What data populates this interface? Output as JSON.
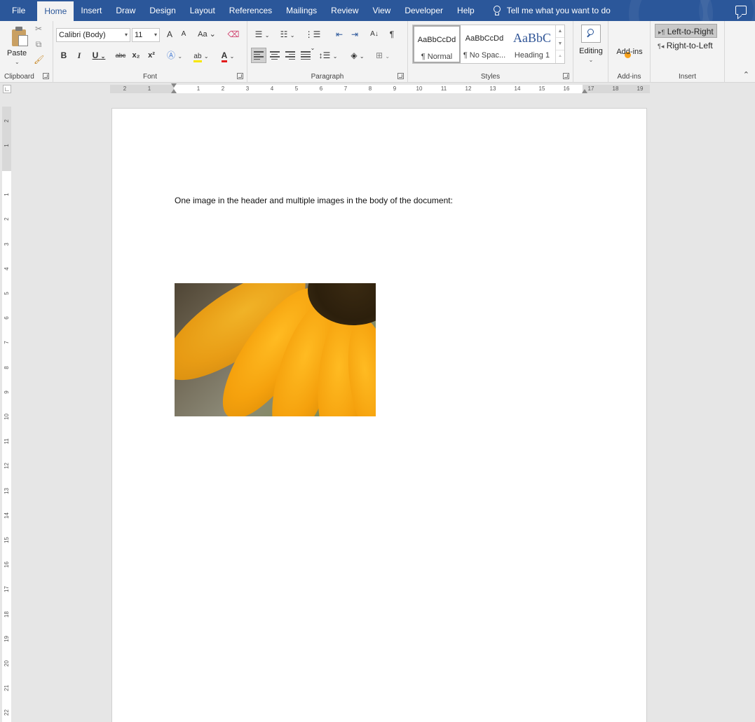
{
  "menu": {
    "tabs": [
      "File",
      "Home",
      "Insert",
      "Draw",
      "Design",
      "Layout",
      "References",
      "Mailings",
      "Review",
      "View",
      "Developer",
      "Help"
    ],
    "active_tab": "Home",
    "tell_me": "Tell me what you want to do"
  },
  "ribbon": {
    "clipboard": {
      "paste_label": "Paste",
      "group_label": "Clipboard"
    },
    "font": {
      "font_name": "Calibri (Body)",
      "font_size": "11",
      "grow": "A",
      "shrink": "A",
      "change_case": "Aa",
      "bold": "B",
      "italic": "I",
      "underline": "U",
      "strikethrough": "abc",
      "subscript": "x₂",
      "superscript": "x²",
      "font_color": "A",
      "group_label": "Font"
    },
    "paragraph": {
      "pilcrow": "¶",
      "group_label": "Paragraph"
    },
    "styles": {
      "items": [
        {
          "sample": "AaBbCcDd",
          "name": "¶ Normal"
        },
        {
          "sample": "AaBbCcDd",
          "name": "¶ No Spac..."
        },
        {
          "sample": "AaBbC",
          "name": "Heading 1"
        }
      ],
      "group_label": "Styles"
    },
    "editing": {
      "label": "Editing"
    },
    "addins": {
      "label": "Add-ins",
      "group_label": "Add-ins"
    },
    "insert": {
      "ltr": "Left-to-Right",
      "rtl": "Right-to-Left",
      "group_label": "Insert"
    }
  },
  "ruler": {
    "horizontal": [
      "2",
      "1",
      "1",
      "2",
      "3",
      "4",
      "5",
      "6",
      "7",
      "8",
      "9",
      "10",
      "11",
      "12",
      "13",
      "14",
      "15",
      "16",
      "17",
      "18",
      "19"
    ],
    "vertical": [
      "2",
      "1",
      "1",
      "2",
      "3",
      "4",
      "5",
      "6",
      "7",
      "8",
      "9",
      "10",
      "11",
      "12",
      "13",
      "14",
      "15",
      "16",
      "17",
      "18",
      "19",
      "20",
      "21",
      "22"
    ]
  },
  "document": {
    "body_text": "One image in the header and multiple images in the body of the document:",
    "image_description": "sunflower-petals"
  },
  "colors": {
    "title_bar": "#2b579a",
    "ribbon": "#f3f3f3",
    "workspace": "#e6e6e6",
    "page": "#ffffff"
  }
}
